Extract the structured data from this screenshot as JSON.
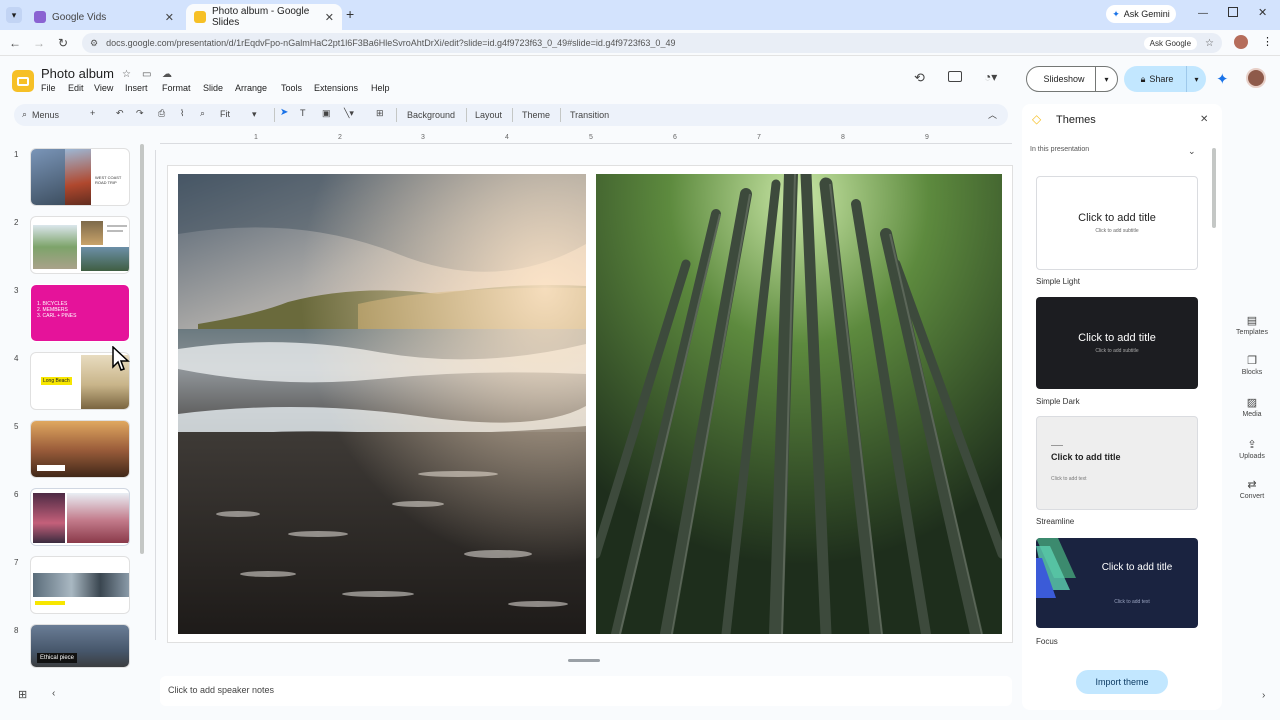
{
  "browser": {
    "tabs": [
      {
        "title": "Google Vids",
        "color": "#8a63d2"
      },
      {
        "title": "Photo album - Google Slides",
        "color": "#f6c026"
      }
    ],
    "new_tab": "+",
    "ask_gemini": "Ask Gemini",
    "url": "docs.google.com/presentation/d/1rEqdvFpo-nGalmHaC2pt1l6F3Ba6HleSvroAhtDrXi/edit?slide=id.g4f9723f63_0_49#slide=id.g4f9723f63_0_49",
    "ask_google": "Ask Google"
  },
  "doc": {
    "title": "Photo album",
    "menus": [
      "File",
      "Edit",
      "View",
      "Insert",
      "Format",
      "Slide",
      "Arrange",
      "Tools",
      "Extensions",
      "Help"
    ],
    "slideshow": "Slideshow",
    "share": "Share"
  },
  "toolbar": {
    "menus_search": "Menus",
    "zoom": "Fit",
    "background": "Background",
    "layout": "Layout",
    "theme": "Theme",
    "transition": "Transition"
  },
  "ruler": [
    "1",
    "2",
    "3",
    "4",
    "5",
    "6",
    "7",
    "8",
    "9"
  ],
  "filmstrip": {
    "numbers": [
      "1",
      "2",
      "3",
      "4",
      "5",
      "6",
      "7",
      "8"
    ],
    "slide1_text": "WEST COAST ROAD TRIP",
    "slide3_lines": [
      "1. BICYCLES",
      "2. MEMBERS",
      "3. CARL + PINES"
    ],
    "slide4_text": "Long Beach",
    "slide8_text": "Ethical piece"
  },
  "notes": {
    "placeholder": "Click to add speaker notes"
  },
  "themes": {
    "title": "Themes",
    "section": "In this presentation",
    "cards": [
      {
        "name": "Simple Light",
        "title": "Click to add title",
        "subtitle": "Click to add subtitle"
      },
      {
        "name": "Simple Dark",
        "title": "Click to add title",
        "subtitle": "Click to add subtitle"
      },
      {
        "name": "Streamline",
        "title": "Click to add title",
        "subtitle": "Click to add text"
      },
      {
        "name": "Focus",
        "title": "Click to add title",
        "subtitle": "Click to add text"
      }
    ],
    "import": "Import theme"
  },
  "right_rail": {
    "items": [
      "Templates",
      "Blocks",
      "Media",
      "Uploads",
      "Convert"
    ]
  }
}
